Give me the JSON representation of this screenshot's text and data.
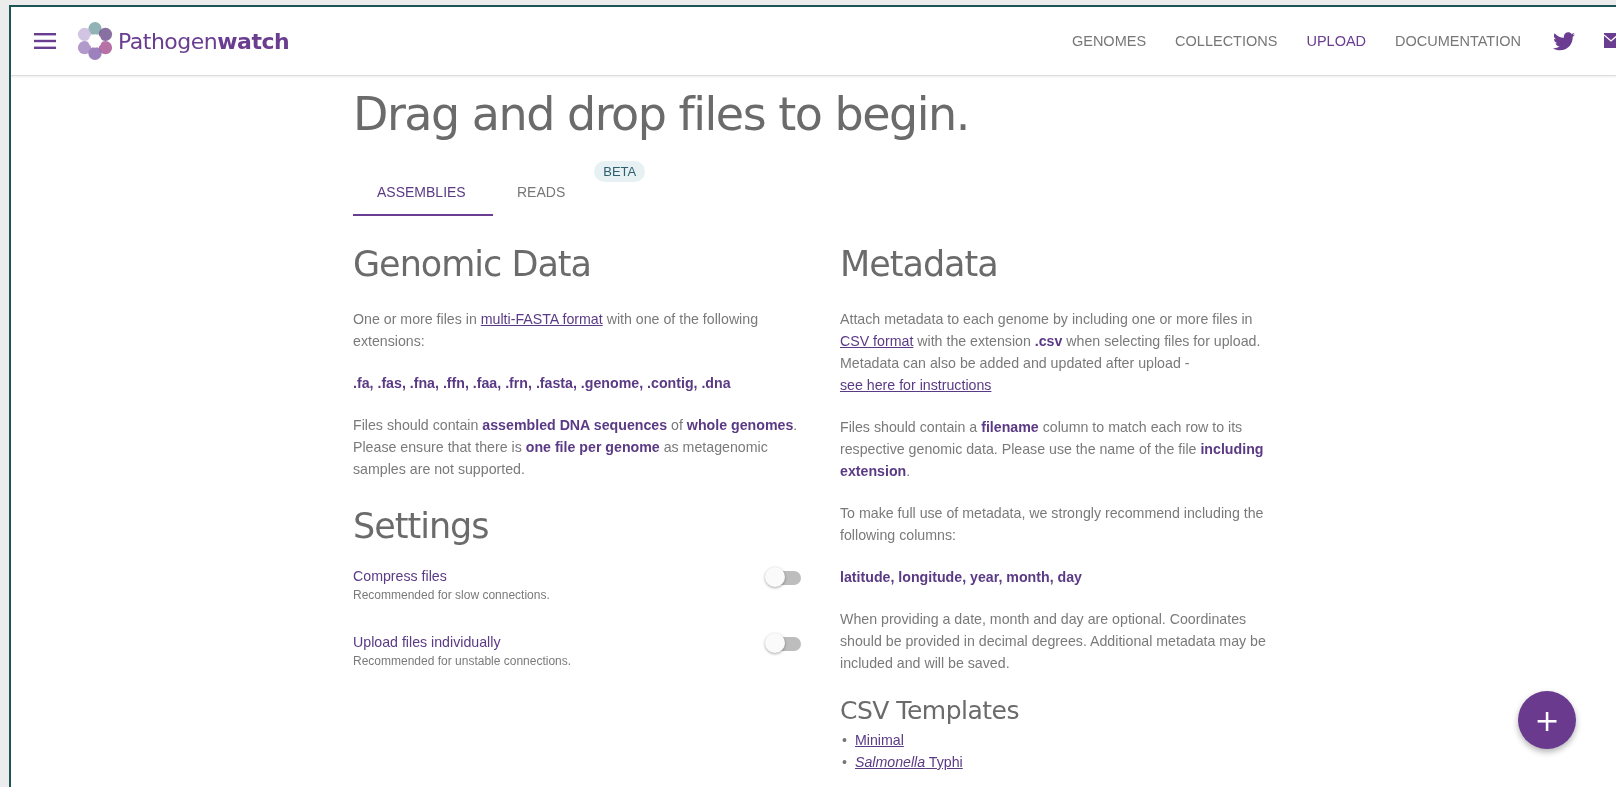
{
  "header": {
    "logo_text": "Pathogen**watch**",
    "nav": [
      {
        "label": "GENOMES",
        "selected": false
      },
      {
        "label": "COLLECTIONS",
        "selected": false
      },
      {
        "label": "UPLOAD",
        "selected": true
      },
      {
        "label": "DOCUMENTATION",
        "selected": false
      }
    ]
  },
  "title": "Drag and drop files to begin.",
  "tabs": [
    {
      "label": "ASSEMBLIES",
      "selected": true
    },
    {
      "label": "READS",
      "selected": false,
      "badge": "BETA"
    }
  ],
  "genomic": {
    "heading": "Genomic Data",
    "paragraphs": [
      [
        {
          "kind": "plain",
          "text": "One or more files in "
        },
        {
          "kind": "link",
          "text": "multi-FASTA format"
        },
        {
          "kind": "plain",
          "text": " with one of the following extensions:"
        }
      ],
      [
        {
          "kind": "strong",
          "text": ".fa, .fas, .fna, .ffn, .faa, .frn, .fasta, .genome, .contig, .dna"
        }
      ],
      [
        {
          "kind": "plain",
          "text": "Files should contain "
        },
        {
          "kind": "strong",
          "text": "assembled DNA sequences"
        },
        {
          "kind": "plain",
          "text": " of "
        },
        {
          "kind": "strong",
          "text": "whole genomes"
        },
        {
          "kind": "plain",
          "text": ". Please ensure that there is "
        },
        {
          "kind": "strong",
          "text": "one file per genome"
        },
        {
          "kind": "plain",
          "text": " as metagenomic samples are not supported."
        }
      ]
    ]
  },
  "settings": {
    "heading": "Settings",
    "items": [
      {
        "label": "Compress files",
        "hint": "Recommended for slow connections.",
        "on": false
      },
      {
        "label": "Upload files individually",
        "hint": "Recommended for unstable connections.",
        "on": false
      }
    ]
  },
  "metadata": {
    "heading": "Metadata",
    "paragraphs": [
      [
        {
          "kind": "plain",
          "text": "Attach metadata to each genome by including one or more files in "
        },
        {
          "kind": "link",
          "text": "CSV format"
        },
        {
          "kind": "plain",
          "text": " with the extension "
        },
        {
          "kind": "strong",
          "text": ".csv"
        },
        {
          "kind": "plain",
          "text": " when selecting files for upload. Metadata can also be added and updated after upload - "
        },
        {
          "kind": "link",
          "text": "see here for instructions"
        }
      ],
      [
        {
          "kind": "plain",
          "text": "Files should contain a "
        },
        {
          "kind": "strong",
          "text": "filename"
        },
        {
          "kind": "plain",
          "text": " column to match each row to its respective genomic data. Please use the name of the file "
        },
        {
          "kind": "strong",
          "text": "including extension"
        },
        {
          "kind": "plain",
          "text": "."
        }
      ],
      [
        {
          "kind": "plain",
          "text": "To make full use of metadata, we strongly recommend including the following columns:"
        }
      ],
      [
        {
          "kind": "strong",
          "text": "latitude, longitude, year, month, day"
        }
      ],
      [
        {
          "kind": "plain",
          "text": "When providing a date, month and day are optional. Coordinates should be provided in decimal degrees. Additional metadata may be included and will be saved."
        }
      ]
    ]
  },
  "templates": {
    "heading": "CSV Templates",
    "links": [
      {
        "bullet": "•",
        "text": "Minimal"
      },
      {
        "bullet": "•",
        "text": "*Salmonella* Typhi"
      }
    ]
  },
  "fab": {
    "label": "+"
  }
}
